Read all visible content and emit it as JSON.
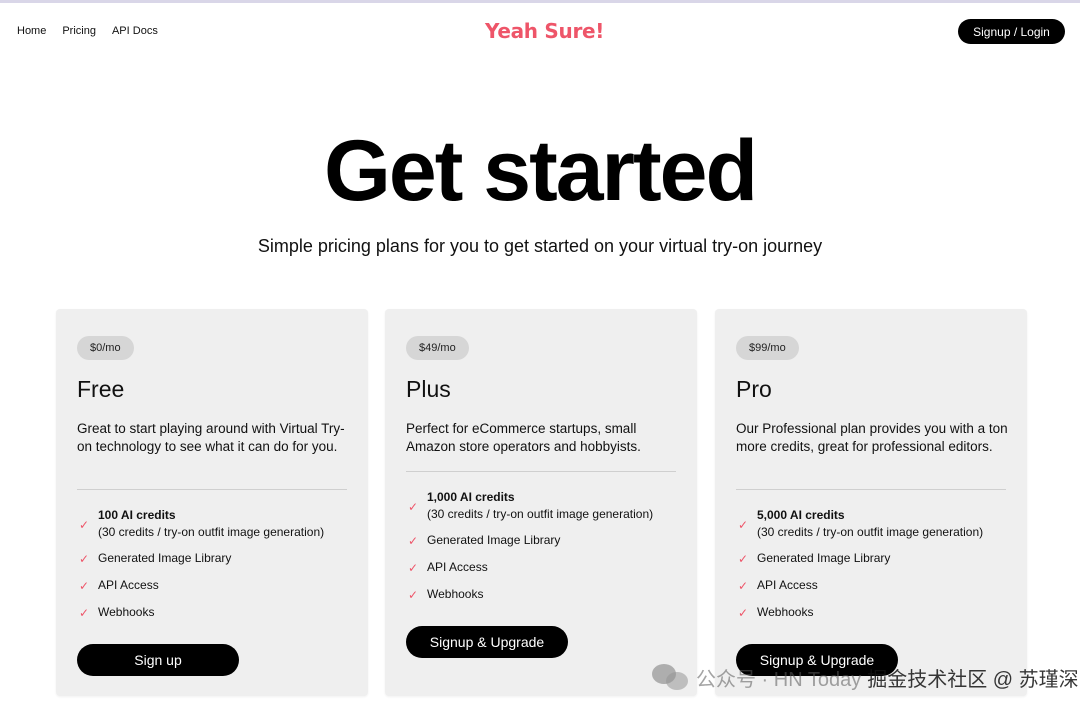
{
  "nav": {
    "items": [
      "Home",
      "Pricing",
      "API Docs"
    ]
  },
  "brand": {
    "name": "Yeah Sure!"
  },
  "auth": {
    "label": "Signup / Login"
  },
  "hero": {
    "title": "Get started",
    "subtitle": "Simple pricing plans for you to get started on your virtual try-on journey"
  },
  "plans": [
    {
      "price": "$0/mo",
      "name": "Free",
      "desc": "Great to start playing around with Virtual Try-on technology to see what it can do for you.",
      "credits": "100 AI credits",
      "credits_note": "(30 credits / try-on outfit image generation)",
      "features": [
        "Generated Image Library",
        "API Access",
        "Webhooks"
      ],
      "cta": "Sign up"
    },
    {
      "price": "$49/mo",
      "name": "Plus",
      "desc": "Perfect for eCommerce startups, small Amazon store operators and hobbyists.",
      "credits": "1,000 AI credits",
      "credits_note": "(30 credits / try-on outfit image generation)",
      "features": [
        "Generated Image Library",
        "API Access",
        "Webhooks"
      ],
      "cta": "Signup & Upgrade"
    },
    {
      "price": "$99/mo",
      "name": "Pro",
      "desc": "Our Professional plan provides you with a ton more credits, great for professional editors.",
      "credits": "5,000 AI credits",
      "credits_note": "(30 credits / try-on outfit image generation)",
      "features": [
        "Generated Image Library",
        "API Access",
        "Webhooks"
      ],
      "cta": "Signup & Upgrade"
    }
  ],
  "watermark": {
    "left": "公众号 · HN Today",
    "right": "掘金技术社区 @ 苏瑾深"
  },
  "colors": {
    "accent": "#ee5569",
    "button": "#000000",
    "card": "#efefef"
  }
}
